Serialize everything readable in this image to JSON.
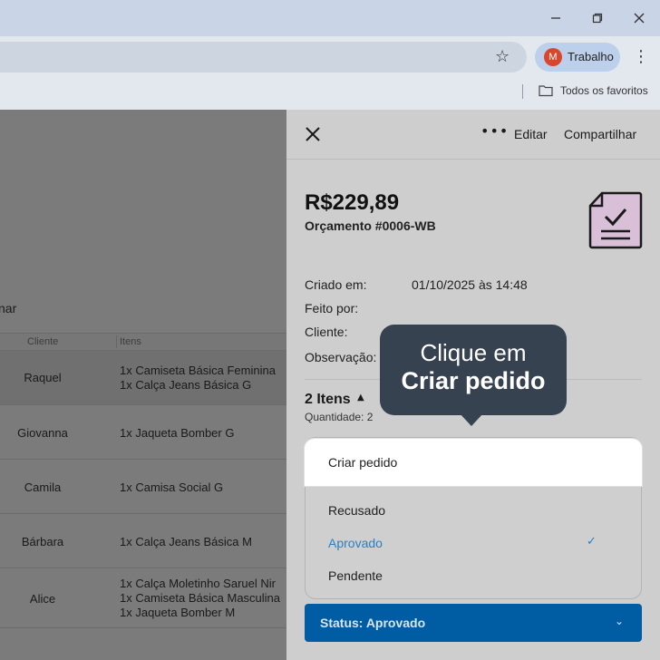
{
  "browser": {
    "profile_initial": "M",
    "profile_name": "Trabalho",
    "bookmarks_folder": "Todos os favoritos",
    "colors": {
      "avatar": "#d8472d",
      "titlebar": "#c9d4e6"
    }
  },
  "app": {
    "truncated_text": "nar",
    "columns": {
      "client": "Cliente",
      "items": "Itens"
    },
    "rows": [
      {
        "client": "Raquel",
        "items": [
          "1x Camiseta Básica Feminina",
          "1x Calça Jeans Básica G"
        ]
      },
      {
        "client": "Giovanna",
        "items": [
          "1x Jaqueta Bomber G"
        ]
      },
      {
        "client": "Camila",
        "items": [
          "1x Camisa Social G"
        ]
      },
      {
        "client": "Bárbara",
        "items": [
          "1x Calça Jeans Básica M"
        ]
      },
      {
        "client": "Alice",
        "items": [
          "1x Calça Moletinho Saruel Nir",
          "1x Camiseta Básica Masculina",
          "1x Jaqueta Bomber M"
        ]
      }
    ]
  },
  "drawer": {
    "edit_label": "Editar",
    "share_label": "Compartilhar",
    "price": "R$229,89",
    "quote_number": "Orçamento #0006-WB",
    "fields": {
      "created_label": "Criado em:",
      "created_value": "01/10/2025 às 14:48",
      "made_by_label": "Feito por:",
      "client_label": "Cliente:",
      "note_label": "Observação:"
    },
    "items_count": "2 Itens",
    "quantity": "Quantidade: 2",
    "menu": {
      "create_order": "Criar pedido",
      "refused": "Recusado",
      "approved": "Aprovado",
      "pending": "Pendente",
      "selected": "Aprovado"
    },
    "status_button": "Status: Aprovado",
    "colors": {
      "accent": "#2880c8",
      "status_bg": "#005ca3",
      "doc_icon": "#d9bfd8"
    }
  },
  "tooltip": {
    "line1": "Clique em",
    "line2": "Criar pedido",
    "bg": "#374250"
  }
}
